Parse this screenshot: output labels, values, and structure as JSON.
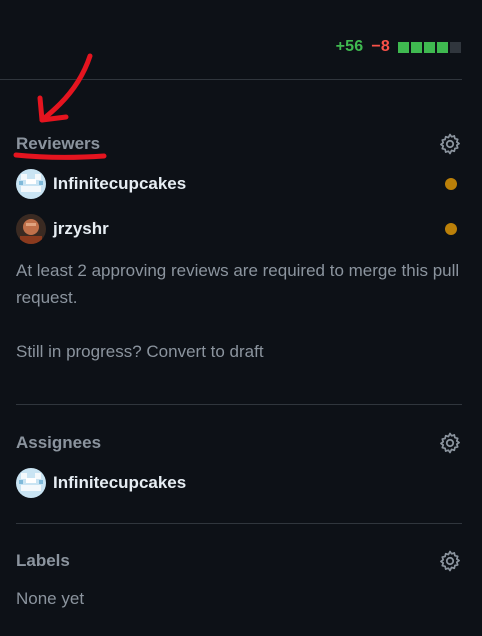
{
  "diffstat": {
    "additions": "+56",
    "deletions": "−8",
    "blocks": [
      "#3fb950",
      "#3fb950",
      "#3fb950",
      "#3fb950",
      "#30363d"
    ]
  },
  "reviewers": {
    "title": "Reviewers",
    "settings_icon": "gear-icon",
    "people": [
      {
        "name": "Infinitecupcakes",
        "avatar": "identicon",
        "status": "pending",
        "status_color": "#bb8009"
      },
      {
        "name": "jrzyshr",
        "avatar": "photo",
        "status": "pending",
        "status_color": "#bb8009"
      }
    ],
    "note": "At least 2 approving reviews are required to merge this pull request.",
    "draft_prefix": "Still in progress?",
    "draft_link": "Convert to draft"
  },
  "assignees": {
    "title": "Assignees",
    "settings_icon": "gear-icon",
    "people": [
      {
        "name": "Infinitecupcakes",
        "avatar": "identicon"
      }
    ]
  },
  "labels": {
    "title": "Labels",
    "settings_icon": "gear-icon",
    "empty_text": "None yet"
  },
  "annotation": {
    "color": "#e5141f",
    "kind": "arrow-and-underline"
  }
}
